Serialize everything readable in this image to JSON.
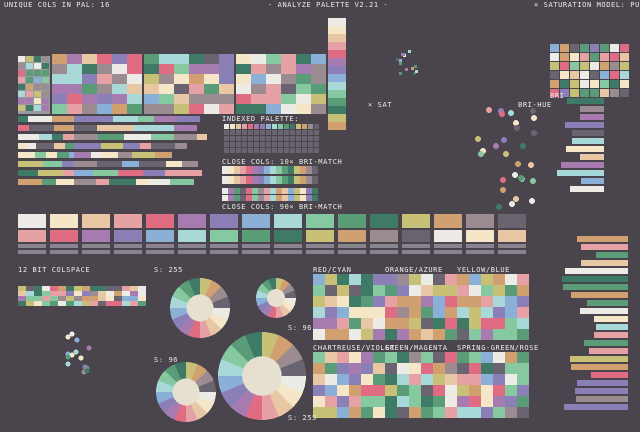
{
  "header": {
    "left": "UNIQUE COLS IN PAL: 16",
    "title": "- ANALYZE PALETTE V2.21 -",
    "right": "× SATURATION MODEL: PURITY"
  },
  "labels": {
    "indexed_palette": "INDEXED PALETTE:",
    "close_10": "CLOSE COLS: 10× BRI-MATCH",
    "close_90": "CLOSE COLS: 90× BRI-MATCH",
    "sat": "× SAT",
    "bri_hue": "BRI-HUE",
    "bri": "BRI",
    "colspace": "12 BIT COLSPACE",
    "s255_a": "S: 255",
    "s96_a": "S: 96",
    "s96_b": "S: 96",
    "s255_b": "S: 255",
    "red_cyan": "RED/CYAN",
    "orange_azure": "ORANGE/AZURE",
    "yellow_blue": "YELLOW/BLUE",
    "chartreuse_violet": "CHARTREUSE/VIOLET",
    "green_magenta": "GREEN/MAGENTA",
    "spring_green_rose": "SPRING-GREEN/ROSE"
  },
  "colors": {
    "background": "#4a454c",
    "text": "#ecebe6",
    "palette": [
      "#ecebe6",
      "#f6e6c8",
      "#e8c8a4",
      "#e6a1a4",
      "#e06c83",
      "#a67bb0",
      "#8a7fb6",
      "#8bb0d8",
      "#a9d8d8",
      "#86c8a0",
      "#5a9c78",
      "#3f7a66",
      "#c8c076",
      "#d0a070",
      "#9a8c90",
      "#6a6470"
    ]
  }
}
